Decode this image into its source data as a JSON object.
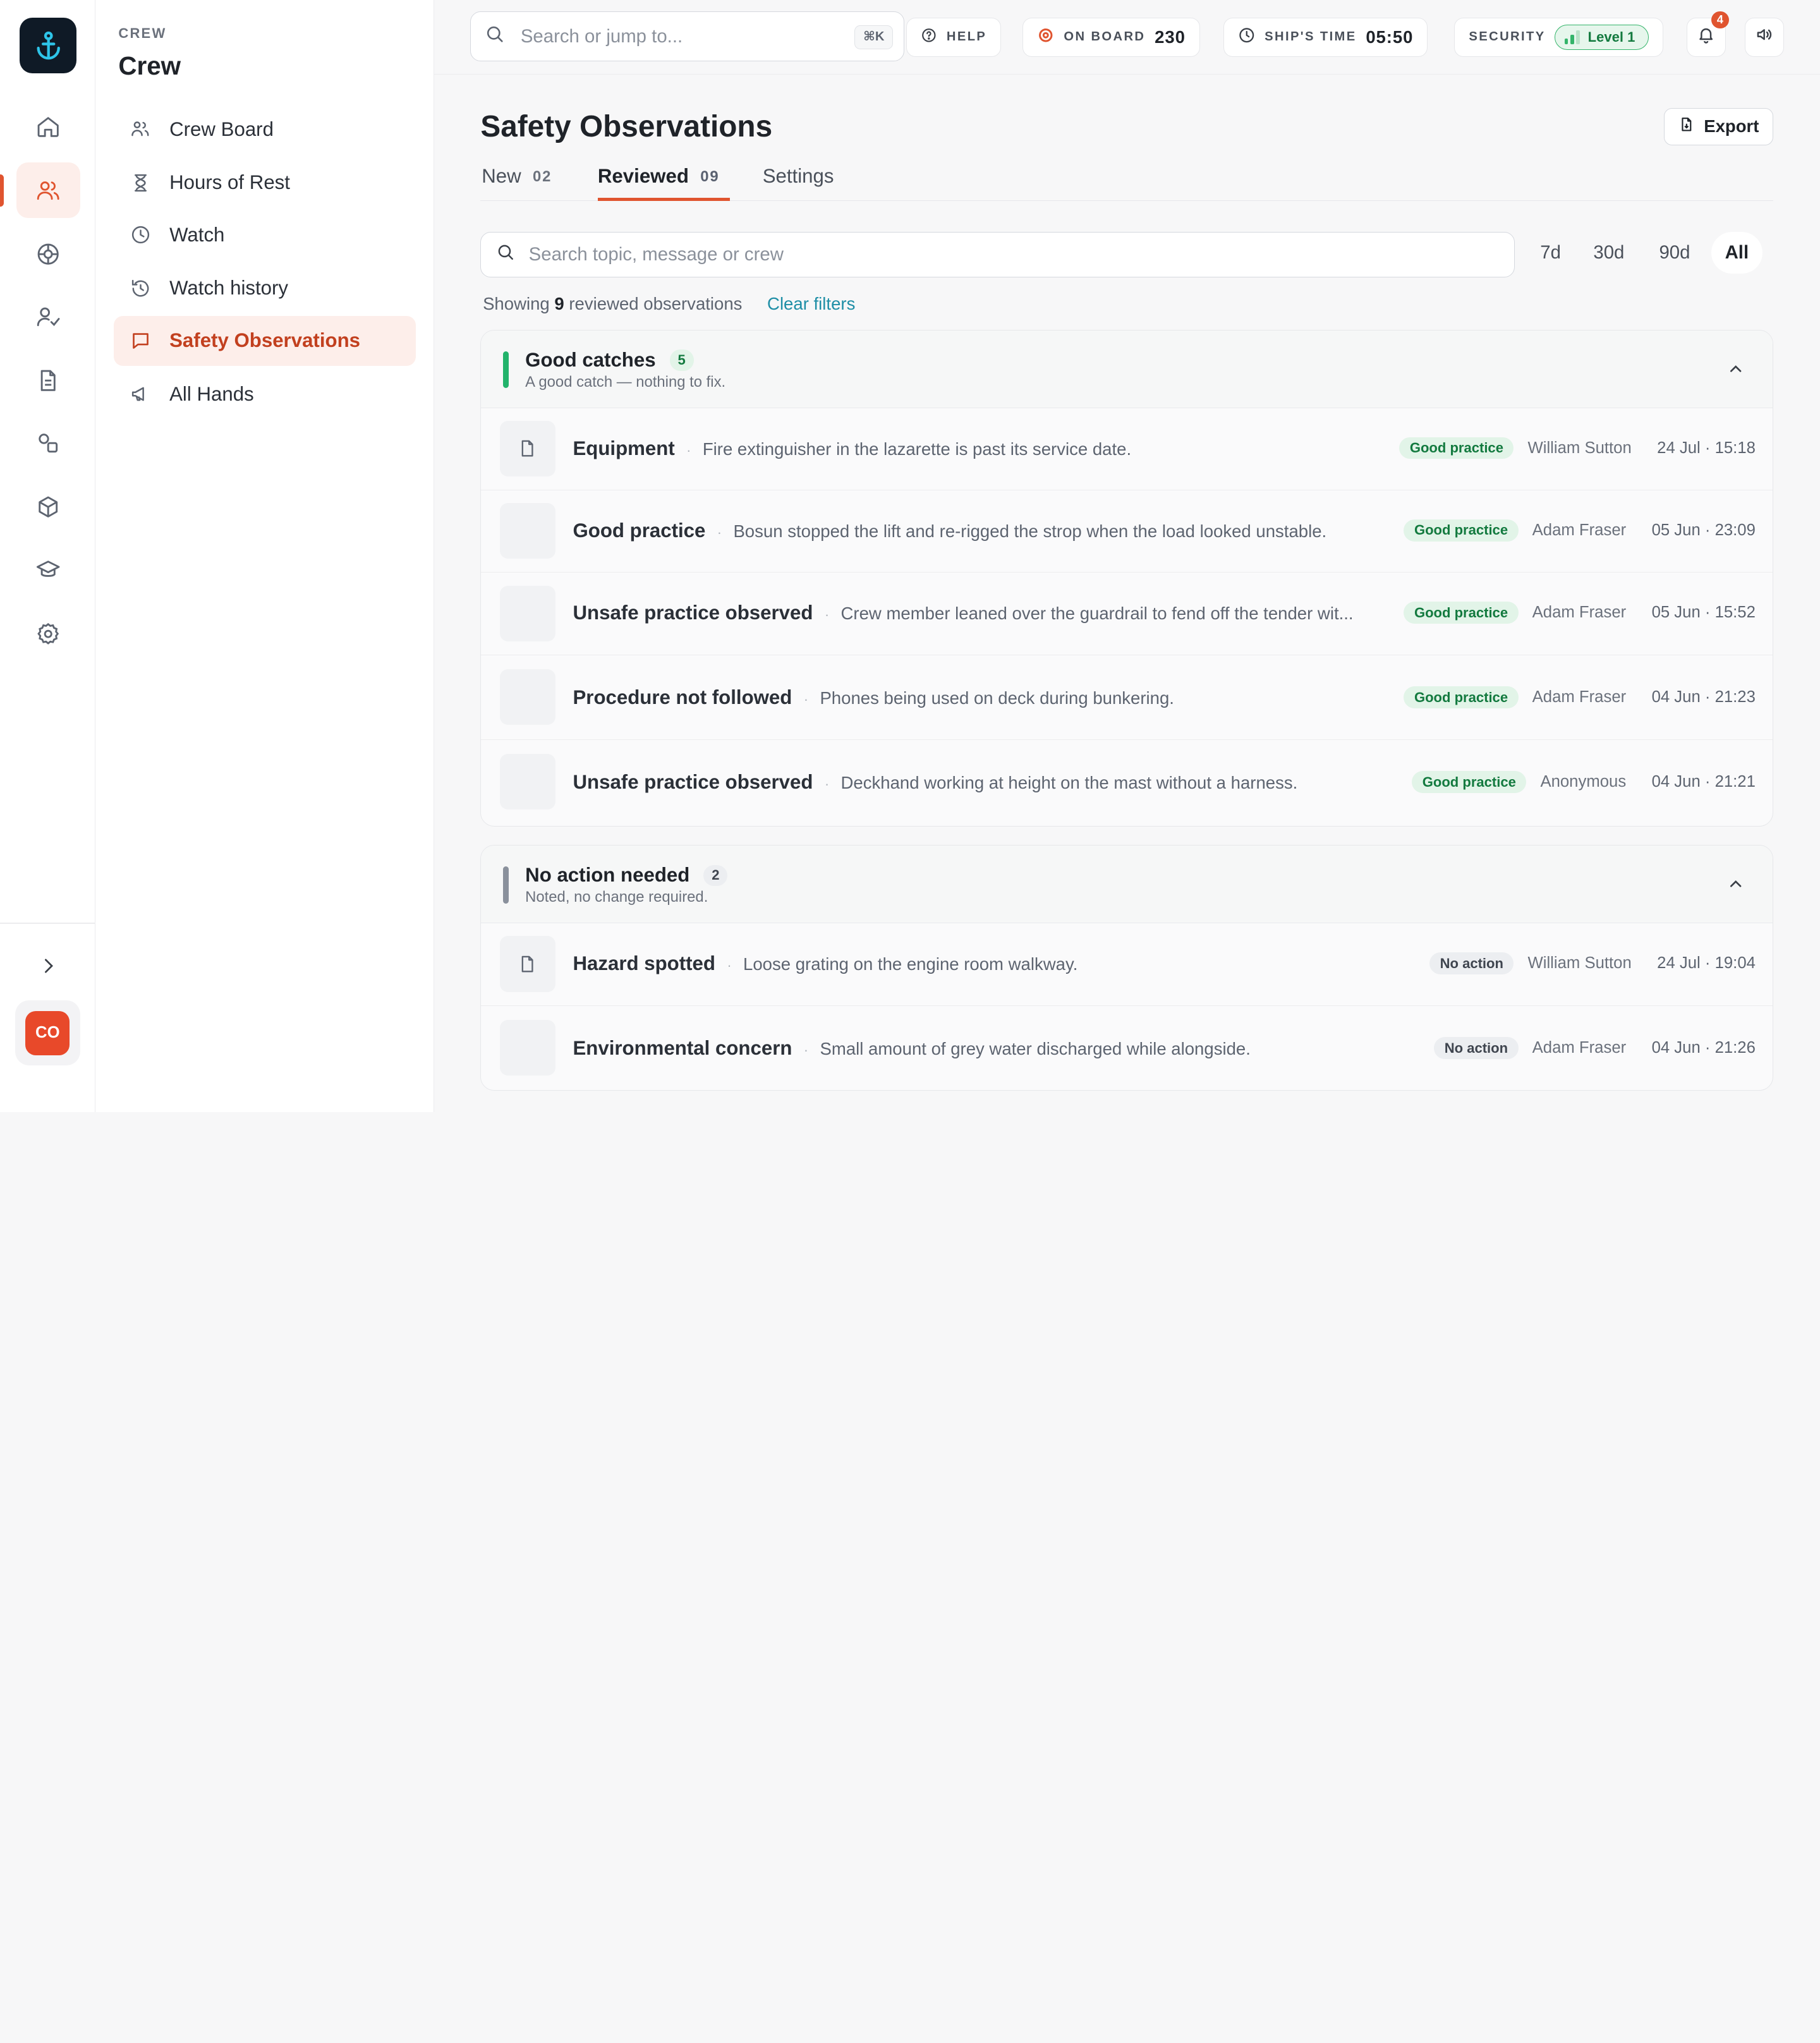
{
  "rail": {
    "items": [
      {
        "name": "home-icon",
        "active": false
      },
      {
        "name": "crew-icon",
        "active": true
      },
      {
        "name": "lifebuoy-icon",
        "active": false
      },
      {
        "name": "user-check-icon",
        "active": false
      },
      {
        "name": "document-icon",
        "active": false
      },
      {
        "name": "shapes-icon",
        "active": false
      },
      {
        "name": "cube-icon",
        "active": false
      },
      {
        "name": "graduation-cap-icon",
        "active": false
      },
      {
        "name": "settings-icon",
        "active": false
      }
    ],
    "avatar_initials": "CO"
  },
  "section": {
    "eyebrow": "CREW",
    "title": "Crew",
    "nav": [
      {
        "label": "Crew Board",
        "icon": "people-icon"
      },
      {
        "label": "Hours of Rest",
        "icon": "hourglass-icon"
      },
      {
        "label": "Watch",
        "icon": "clock-icon"
      },
      {
        "label": "Watch history",
        "icon": "history-icon"
      },
      {
        "label": "Safety Observations",
        "icon": "message-icon",
        "active": true
      },
      {
        "label": "All Hands",
        "icon": "megaphone-icon"
      }
    ]
  },
  "topbar": {
    "search_placeholder": "Search or jump to...",
    "search_shortcut": "⌘K",
    "help": "HELP",
    "on_board_label": "ON BOARD",
    "on_board_value": "230",
    "ships_time_label": "SHIP'S TIME",
    "ships_time_value": "05:50",
    "security_label": "SECURITY",
    "security_level": "Level 1",
    "notifications_count": "4"
  },
  "page": {
    "title": "Safety Observations",
    "export_label": "Export",
    "tabs": [
      {
        "label": "New",
        "count": "02"
      },
      {
        "label": "Reviewed",
        "count": "09",
        "active": true
      },
      {
        "label": "Settings",
        "count": ""
      }
    ],
    "filter_placeholder": "Search topic, message or crew",
    "ranges": [
      "7d",
      "30d",
      "90d",
      "All"
    ],
    "active_range": "All",
    "showing_prefix": "Showing",
    "showing_count": "9",
    "showing_suffix": "reviewed observations",
    "clear_filters": "Clear filters"
  },
  "groups": [
    {
      "title": "Good catches",
      "count": "5",
      "subtitle": "A good catch — nothing to fix.",
      "accent": "#22b36b",
      "items": [
        {
          "topic": "Equipment",
          "message": "Fire extinguisher in the lazarette is past its service date.",
          "tag": "Good practice",
          "author": "William Sutton",
          "when": "24 Jul · 15:18",
          "has_attachment": true
        },
        {
          "topic": "Good practice",
          "message": "Bosun stopped the lift and re-rigged the strop when the load looked unstable.",
          "tag": "Good practice",
          "author": "Adam Fraser",
          "when": "05 Jun · 23:09",
          "has_attachment": false
        },
        {
          "topic": "Unsafe practice observed",
          "message": "Crew member leaned over the guardrail to fend off the tender wit...",
          "tag": "Good practice",
          "author": "Adam Fraser",
          "when": "05 Jun · 15:52",
          "has_attachment": false
        },
        {
          "topic": "Procedure not followed",
          "message": "Phones being used on deck during bunkering.",
          "tag": "Good practice",
          "author": "Adam Fraser",
          "when": "04 Jun · 21:23",
          "has_attachment": false
        },
        {
          "topic": "Unsafe practice observed",
          "message": "Deckhand working at height on the mast without a harness.",
          "tag": "Good practice",
          "author": "Anonymous",
          "when": "04 Jun · 21:21",
          "has_attachment": false
        }
      ]
    },
    {
      "title": "No action needed",
      "count": "2",
      "subtitle": "Noted, no change required.",
      "accent": "#8a919c",
      "items": [
        {
          "topic": "Hazard spotted",
          "message": "Loose grating on the engine room walkway.",
          "tag": "No action",
          "author": "William Sutton",
          "when": "24 Jul · 19:04",
          "has_attachment": true
        },
        {
          "topic": "Environmental concern",
          "message": "Small amount of grey water discharged while alongside.",
          "tag": "No action",
          "author": "Adam Fraser",
          "when": "04 Jun · 21:26",
          "has_attachment": false
        }
      ]
    }
  ]
}
